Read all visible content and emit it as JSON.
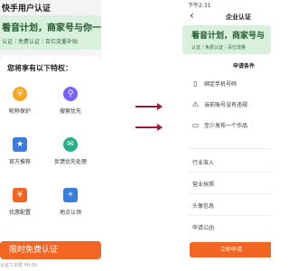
{
  "left": {
    "title": "快手用户认证",
    "banner": {
      "main": "看音计划，商家号与你一起",
      "sub": "认证｜免费认证｜百亿流量补贴"
    },
    "privileges_title": "您将享有以下特权：",
    "features": [
      {
        "label": "昵称保护",
        "icon": "shield-icon",
        "color": "#f5a623"
      },
      {
        "label": "搜索优先",
        "icon": "search-icon",
        "color": "#7b61ff"
      },
      {
        "label": "官方推荐",
        "icon": "recommend-icon",
        "color": "#3b7ddd"
      },
      {
        "label": "反馈优先处理",
        "icon": "feedback-icon",
        "color": "#22b08c"
      },
      {
        "label": "优惠配置",
        "icon": "coupon-icon",
        "color": "#f26522"
      },
      {
        "label": "地点认领",
        "icon": "location-icon",
        "color": "#3b7ddd"
      }
    ],
    "cta_label": "限时免费认证",
    "price_text": "认证工本费 ¥0.00"
  },
  "right": {
    "time": "下午2:31",
    "title": "企业认证",
    "banner": {
      "main": "看音计划，商家号与",
      "sub": "认证｜免费认证｜百亿流量"
    },
    "conditions_title": "申请条件",
    "conditions": [
      {
        "label": "绑定手机号码",
        "icon": "phone-icon"
      },
      {
        "label": "当前账号没有违规",
        "icon": "warning-icon"
      },
      {
        "label": "至少发布一个作品",
        "icon": "folder-icon"
      }
    ],
    "fields": [
      "行业准入",
      "营业执照",
      "头像信息",
      "申请公函"
    ],
    "submit_label": "立即申请"
  },
  "colors": {
    "accent": "#f26522",
    "arrow": "#9b1b30",
    "banner_bg": "#d8f0dc"
  }
}
